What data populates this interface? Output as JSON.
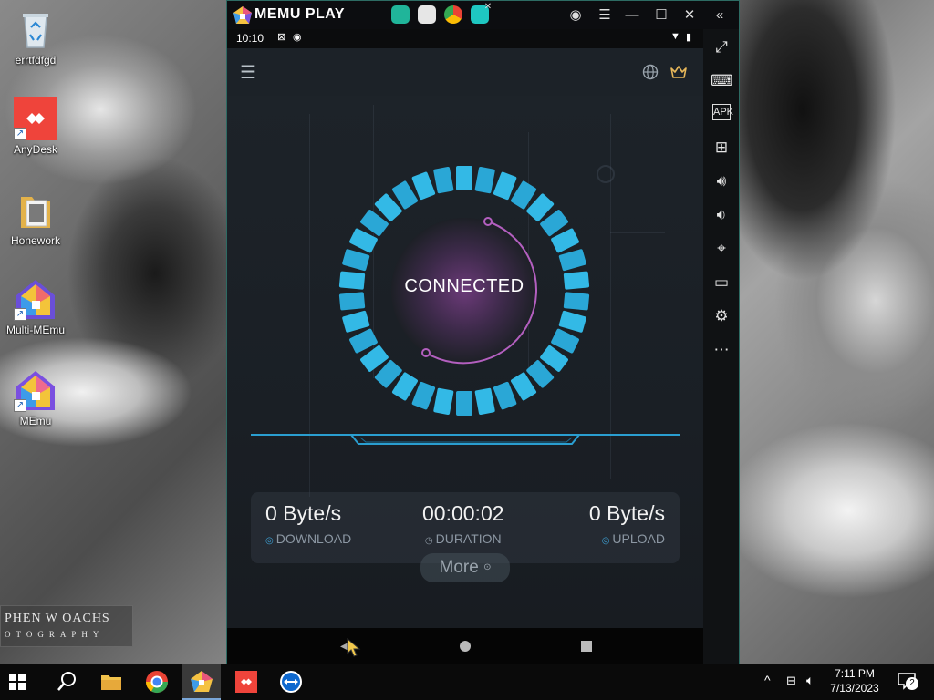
{
  "desktop": {
    "icons": [
      {
        "label": "errtfdfgd",
        "icon": "recycle-bin-icon"
      },
      {
        "label": "AnyDesk",
        "icon": "anydesk-icon"
      },
      {
        "label": "Honework",
        "icon": "folder-icon"
      },
      {
        "label": "Multi-MEmu",
        "icon": "multi-memu-icon"
      },
      {
        "label": "MEmu",
        "icon": "memu-icon"
      }
    ],
    "watermark": {
      "line1": "PHEN W OACHS",
      "line2": "OTOGRAPHY"
    }
  },
  "memu": {
    "brand": "MEMU PLAY",
    "status_bar": {
      "time": "10:10"
    },
    "vpn": {
      "status": "CONNECTED",
      "stats": {
        "download": {
          "value": "0 Byte/s",
          "label": "DOWNLOAD"
        },
        "duration": {
          "value": "00:00:02",
          "label": "DURATION"
        },
        "upload": {
          "value": "0 Byte/s",
          "label": "UPLOAD"
        }
      },
      "more_label": "More"
    },
    "sidebar_tools": [
      "fullscreen-icon",
      "keyboard-icon",
      "apk-icon",
      "add-app-icon",
      "volume-up-icon",
      "volume-down-icon",
      "location-icon",
      "folder-icon",
      "settings-icon",
      "more-icon"
    ]
  },
  "taskbar": {
    "time": "7:11 PM",
    "date": "7/13/2023",
    "notification_count": "2"
  },
  "colors": {
    "accent_cyan": "#2ab3e0",
    "ring_purple": "#b35fbf",
    "memu_border": "#2d6b63"
  }
}
